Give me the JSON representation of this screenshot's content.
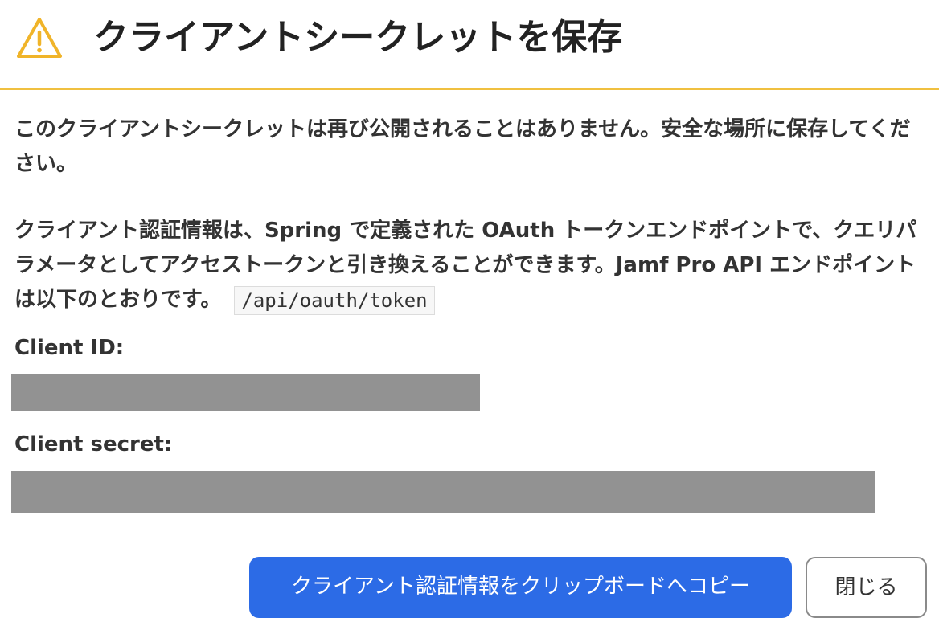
{
  "dialog": {
    "title": "クライアントシークレットを保存",
    "warning_icon": "warning-triangle-icon",
    "accent_color": "#f0c040"
  },
  "body": {
    "notice": "このクライアントシークレットは再び公開されることはありません。安全な場所に保存してください。",
    "description": "クライアント認証情報は、Spring で定義された OAuth トークンエンドポイントで、クエリパラメータとしてアクセストークンと引き換えることができます。Jamf Pro API エンドポイントは以下のとおりです。",
    "endpoint": "/api/oauth/token"
  },
  "fields": {
    "client_id_label": "Client ID:",
    "client_secret_label": "Client secret:"
  },
  "buttons": {
    "copy_label": "クライアント認証情報をクリップボードへコピー",
    "close_label": "閉じる",
    "primary_color": "#2c6be6"
  }
}
